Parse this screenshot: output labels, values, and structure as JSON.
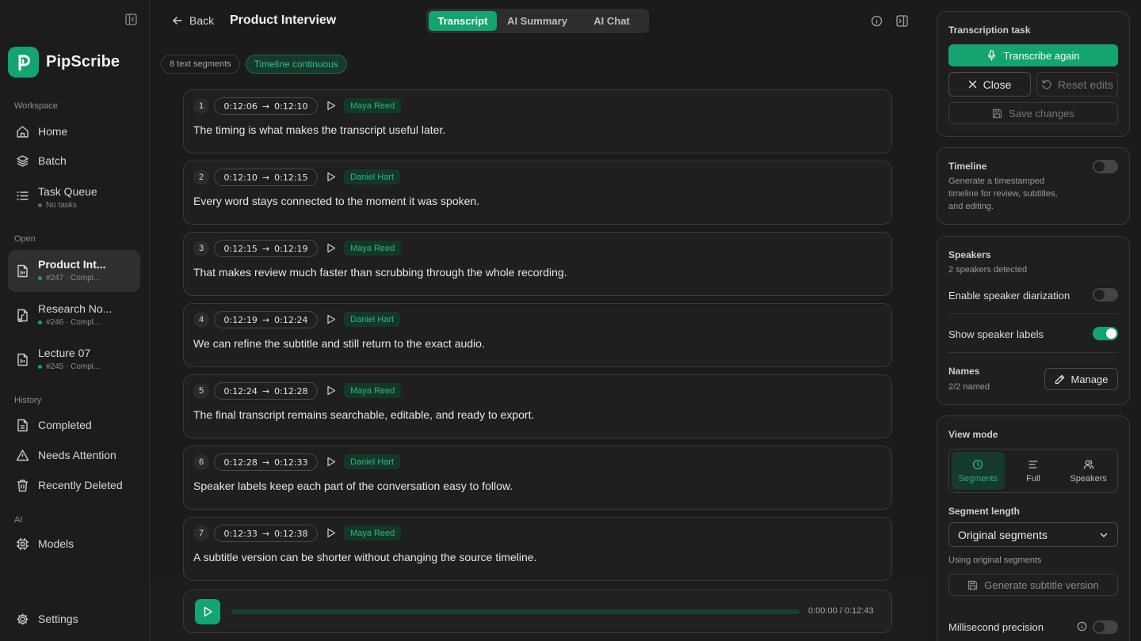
{
  "app": {
    "name": "PipScribe"
  },
  "sidebar": {
    "sections": {
      "workspace": "Workspace",
      "open": "Open",
      "history": "History",
      "ai": "AI"
    },
    "workspace_items": [
      {
        "label": "Home",
        "icon": "home-icon"
      },
      {
        "label": "Batch",
        "icon": "layers-icon"
      },
      {
        "label": "Task Queue",
        "icon": "list-icon",
        "sub": "No tasks"
      }
    ],
    "open_items": [
      {
        "title": "Product Int...",
        "sub": "#247 · Compl...",
        "active": true
      },
      {
        "title": "Research No...",
        "sub": "#246 · Compl...",
        "active": false
      },
      {
        "title": "Lecture 07",
        "sub": "#245 · Compl...",
        "active": false
      }
    ],
    "history_items": [
      {
        "label": "Completed",
        "icon": "document-icon"
      },
      {
        "label": "Needs Attention",
        "icon": "warning-icon"
      },
      {
        "label": "Recently Deleted",
        "icon": "trash-icon"
      }
    ],
    "ai_items": [
      {
        "label": "Models",
        "icon": "chip-icon"
      }
    ],
    "settings_label": "Settings"
  },
  "header": {
    "back_label": "Back",
    "title": "Product Interview",
    "tabs": [
      {
        "label": "Transcript",
        "active": true
      },
      {
        "label": "AI Summary",
        "active": false
      },
      {
        "label": "AI Chat",
        "active": false
      }
    ]
  },
  "chips": {
    "segments": "8 text segments",
    "timeline": "Timeline continuous"
  },
  "segments": [
    {
      "num": "1",
      "start": "0:12:06",
      "end": "0:12:10",
      "speaker": "Maya Reed",
      "text": "The timing is what makes the transcript useful later."
    },
    {
      "num": "2",
      "start": "0:12:10",
      "end": "0:12:15",
      "speaker": "Daniel Hart",
      "text": "Every word stays connected to the moment it was spoken."
    },
    {
      "num": "3",
      "start": "0:12:15",
      "end": "0:12:19",
      "speaker": "Maya Reed",
      "text": "That makes review much faster than scrubbing through the whole recording."
    },
    {
      "num": "4",
      "start": "0:12:19",
      "end": "0:12:24",
      "speaker": "Daniel Hart",
      "text": "We can refine the subtitle and still return to the exact audio."
    },
    {
      "num": "5",
      "start": "0:12:24",
      "end": "0:12:28",
      "speaker": "Maya Reed",
      "text": "The final transcript remains searchable, editable, and ready to export."
    },
    {
      "num": "6",
      "start": "0:12:28",
      "end": "0:12:33",
      "speaker": "Daniel Hart",
      "text": "Speaker labels keep each part of the conversation easy to follow."
    },
    {
      "num": "7",
      "start": "0:12:33",
      "end": "0:12:38",
      "speaker": "Maya Reed",
      "text": "A subtitle version can be shorter without changing the source timeline."
    }
  ],
  "player": {
    "time": "0:00:00 / 0:12:43",
    "progress": 0
  },
  "panel": {
    "task": {
      "title": "Transcription task",
      "transcribe_again": "Transcribe again",
      "close": "Close",
      "reset_edits": "Reset edits",
      "save_changes": "Save changes"
    },
    "timeline": {
      "title": "Timeline",
      "desc1": "Generate a timestamped",
      "desc2": "timeline for review, subtitles,",
      "desc3": "and editing.",
      "enabled": false
    },
    "speakers": {
      "title": "Speakers",
      "detected": "2 speakers detected",
      "diarization_label": "Enable speaker diarization",
      "diarization_enabled": false,
      "labels_label": "Show speaker labels",
      "labels_enabled": true,
      "names_title": "Names",
      "names_count": "2/2 named",
      "manage": "Manage"
    },
    "view": {
      "title": "View mode",
      "modes": [
        {
          "label": "Segments",
          "active": true
        },
        {
          "label": "Full",
          "active": false
        },
        {
          "label": "Speakers",
          "active": false
        }
      ],
      "segment_length_title": "Segment length",
      "segment_length_value": "Original segments",
      "segment_length_note": "Using original segments",
      "generate_subtitle": "Generate subtitle version",
      "ms_precision_label": "Millisecond precision",
      "ms_precision_enabled": false
    }
  },
  "colors": {
    "accent": "#13a46f",
    "background": "#1b1b1b",
    "speaker_tag": "#27ba82"
  }
}
